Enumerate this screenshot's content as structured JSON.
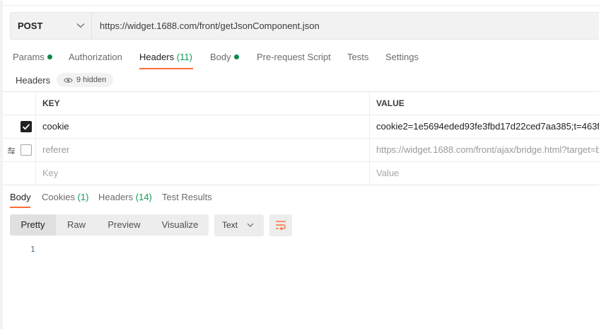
{
  "request": {
    "method": "POST",
    "url": "https://widget.1688.com/front/getJsonComponent.json"
  },
  "request_tabs": [
    {
      "label": "Params",
      "count": "",
      "dot": true
    },
    {
      "label": "Authorization",
      "count": "",
      "dot": false
    },
    {
      "label": "Headers",
      "count": "(11)",
      "dot": false
    },
    {
      "label": "Body",
      "count": "",
      "dot": true
    },
    {
      "label": "Pre-request Script",
      "count": "",
      "dot": false
    },
    {
      "label": "Tests",
      "count": "",
      "dot": false
    },
    {
      "label": "Settings",
      "count": "",
      "dot": false
    }
  ],
  "headers_section": {
    "label": "Headers",
    "hidden": "9 hidden"
  },
  "headers_table": {
    "columns": [
      "KEY",
      "VALUE"
    ],
    "rows": [
      {
        "checked": true,
        "key": "cookie",
        "value": "cookie2=1e5694eded93fe3fbd17d22ced7aa385;t=463f"
      },
      {
        "checked": false,
        "key": "referer",
        "value": "https://widget.1688.com/front/ajax/bridge.html?target=b"
      }
    ],
    "new_row": {
      "key_placeholder": "Key",
      "value_placeholder": "Value"
    }
  },
  "response_tabs": [
    {
      "label": "Body",
      "count": ""
    },
    {
      "label": "Cookies",
      "count": "(1)"
    },
    {
      "label": "Headers",
      "count": "(14)"
    },
    {
      "label": "Test Results",
      "count": ""
    }
  ],
  "view_modes": [
    "Pretty",
    "Raw",
    "Preview",
    "Visualize"
  ],
  "active_view_mode": "Pretty",
  "format": "Text",
  "editor": {
    "line_numbers": [
      "1"
    ]
  },
  "colors": {
    "accent": "#ff6c37",
    "count_green": "#0f9d58",
    "dot_green": "#0f8a48"
  },
  "icons": [
    "chevron-down-icon",
    "eye-icon",
    "drag-handle-icon",
    "checkbox-icon",
    "wrap-lines-icon"
  ]
}
